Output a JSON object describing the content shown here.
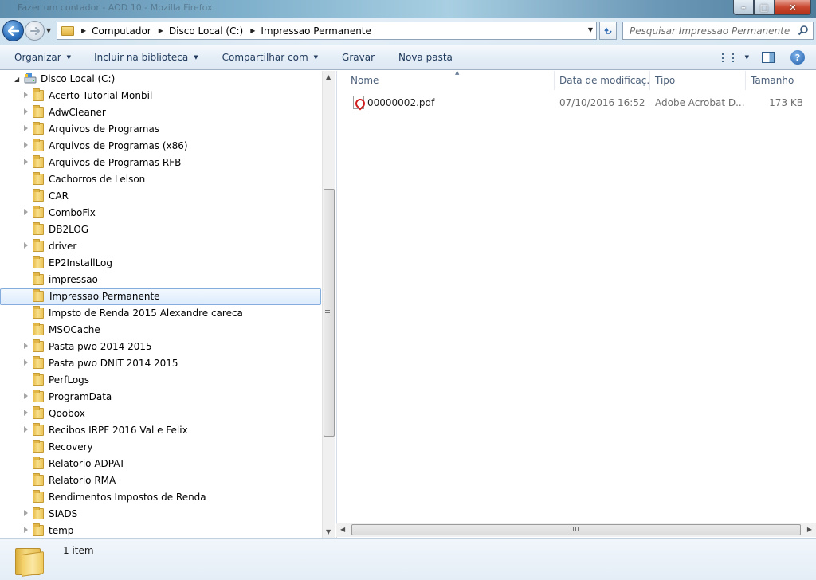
{
  "window": {
    "title": "Fazer um contador - AOD 10 - Mozilla Firefox",
    "min_glyph": "–",
    "max_glyph": "□",
    "close_glyph": "✕"
  },
  "address": {
    "crumbs": [
      "Computador",
      "Disco Local (C:)",
      "Impressao Permanente"
    ]
  },
  "search": {
    "placeholder": "Pesquisar Impressao Permanente"
  },
  "toolbar": {
    "organize": "Organizar",
    "include_library": "Incluir na biblioteca",
    "share_with": "Compartilhar com",
    "burn": "Gravar",
    "new_folder": "Nova pasta",
    "help": "?"
  },
  "nav": {
    "root": "Disco Local (C:)",
    "folders": [
      {
        "name": "Acerto Tutorial Monbil",
        "expandable": true
      },
      {
        "name": "AdwCleaner",
        "expandable": true
      },
      {
        "name": "Arquivos de Programas",
        "expandable": true
      },
      {
        "name": "Arquivos de Programas (x86)",
        "expandable": true
      },
      {
        "name": "Arquivos de Programas RFB",
        "expandable": true
      },
      {
        "name": "Cachorros de Lelson",
        "expandable": false
      },
      {
        "name": "CAR",
        "expandable": false
      },
      {
        "name": "ComboFix",
        "expandable": true
      },
      {
        "name": "DB2LOG",
        "expandable": false
      },
      {
        "name": "driver",
        "expandable": true
      },
      {
        "name": "EP2InstallLog",
        "expandable": false
      },
      {
        "name": "impressao",
        "expandable": false
      },
      {
        "name": "Impressao Permanente",
        "expandable": false,
        "selected": true
      },
      {
        "name": "Impsto de Renda 2015 Alexandre careca",
        "expandable": false
      },
      {
        "name": "MSOCache",
        "expandable": false
      },
      {
        "name": "Pasta pwo 2014 2015",
        "expandable": true
      },
      {
        "name": "Pasta pwo DNIT 2014 2015",
        "expandable": true
      },
      {
        "name": "PerfLogs",
        "expandable": false
      },
      {
        "name": "ProgramData",
        "expandable": true
      },
      {
        "name": "Qoobox",
        "expandable": true
      },
      {
        "name": "Recibos IRPF 2016 Val e Felix",
        "expandable": true
      },
      {
        "name": "Recovery",
        "expandable": false
      },
      {
        "name": "Relatorio ADPAT",
        "expandable": false
      },
      {
        "name": "Relatorio RMA",
        "expandable": false
      },
      {
        "name": "Rendimentos  Impostos de Renda",
        "expandable": false
      },
      {
        "name": "SIADS",
        "expandable": true
      },
      {
        "name": "temp",
        "expandable": true
      }
    ]
  },
  "files": {
    "columns": [
      "Nome",
      "Data de modificaç...",
      "Tipo",
      "Tamanho"
    ],
    "rows": [
      {
        "name": "00000002.pdf",
        "modified": "07/10/2016 16:52",
        "type": "Adobe Acrobat D...",
        "size": "173 KB",
        "icon": "pdf-icon"
      }
    ]
  },
  "status": {
    "count": "1 item"
  }
}
